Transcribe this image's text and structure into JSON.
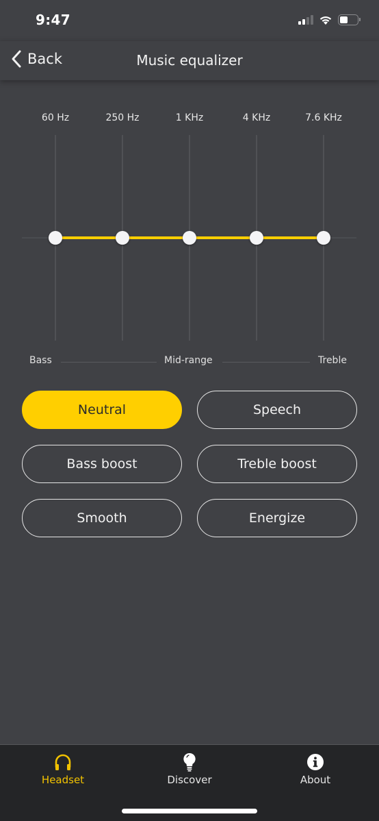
{
  "status_bar": {
    "time": "9:47",
    "signal_bars_active": 2,
    "signal_bars_total": 4,
    "battery_level_percent": 40
  },
  "header": {
    "back_label": "Back",
    "title": "Music equalizer"
  },
  "equalizer": {
    "bands": [
      {
        "label": "60 Hz",
        "value": 0
      },
      {
        "label": "250 Hz",
        "value": 0
      },
      {
        "label": "1 KHz",
        "value": 0
      },
      {
        "label": "4 KHz",
        "value": 0
      },
      {
        "label": "7.6 KHz",
        "value": 0
      }
    ],
    "range": [
      -1,
      1
    ],
    "accent_color": "#ffcf00",
    "range_labels": {
      "low": "Bass",
      "mid": "Mid-range",
      "high": "Treble"
    }
  },
  "presets": [
    {
      "label": "Neutral",
      "active": true
    },
    {
      "label": "Speech",
      "active": false
    },
    {
      "label": "Bass boost",
      "active": false
    },
    {
      "label": "Treble boost",
      "active": false
    },
    {
      "label": "Smooth",
      "active": false
    },
    {
      "label": "Energize",
      "active": false
    }
  ],
  "tab_bar": {
    "items": [
      {
        "label": "Headset",
        "icon": "headphones-icon",
        "active": true
      },
      {
        "label": "Discover",
        "icon": "lightbulb-icon",
        "active": false
      },
      {
        "label": "About",
        "icon": "info-icon",
        "active": false
      }
    ],
    "active_color": "#f2c200"
  }
}
